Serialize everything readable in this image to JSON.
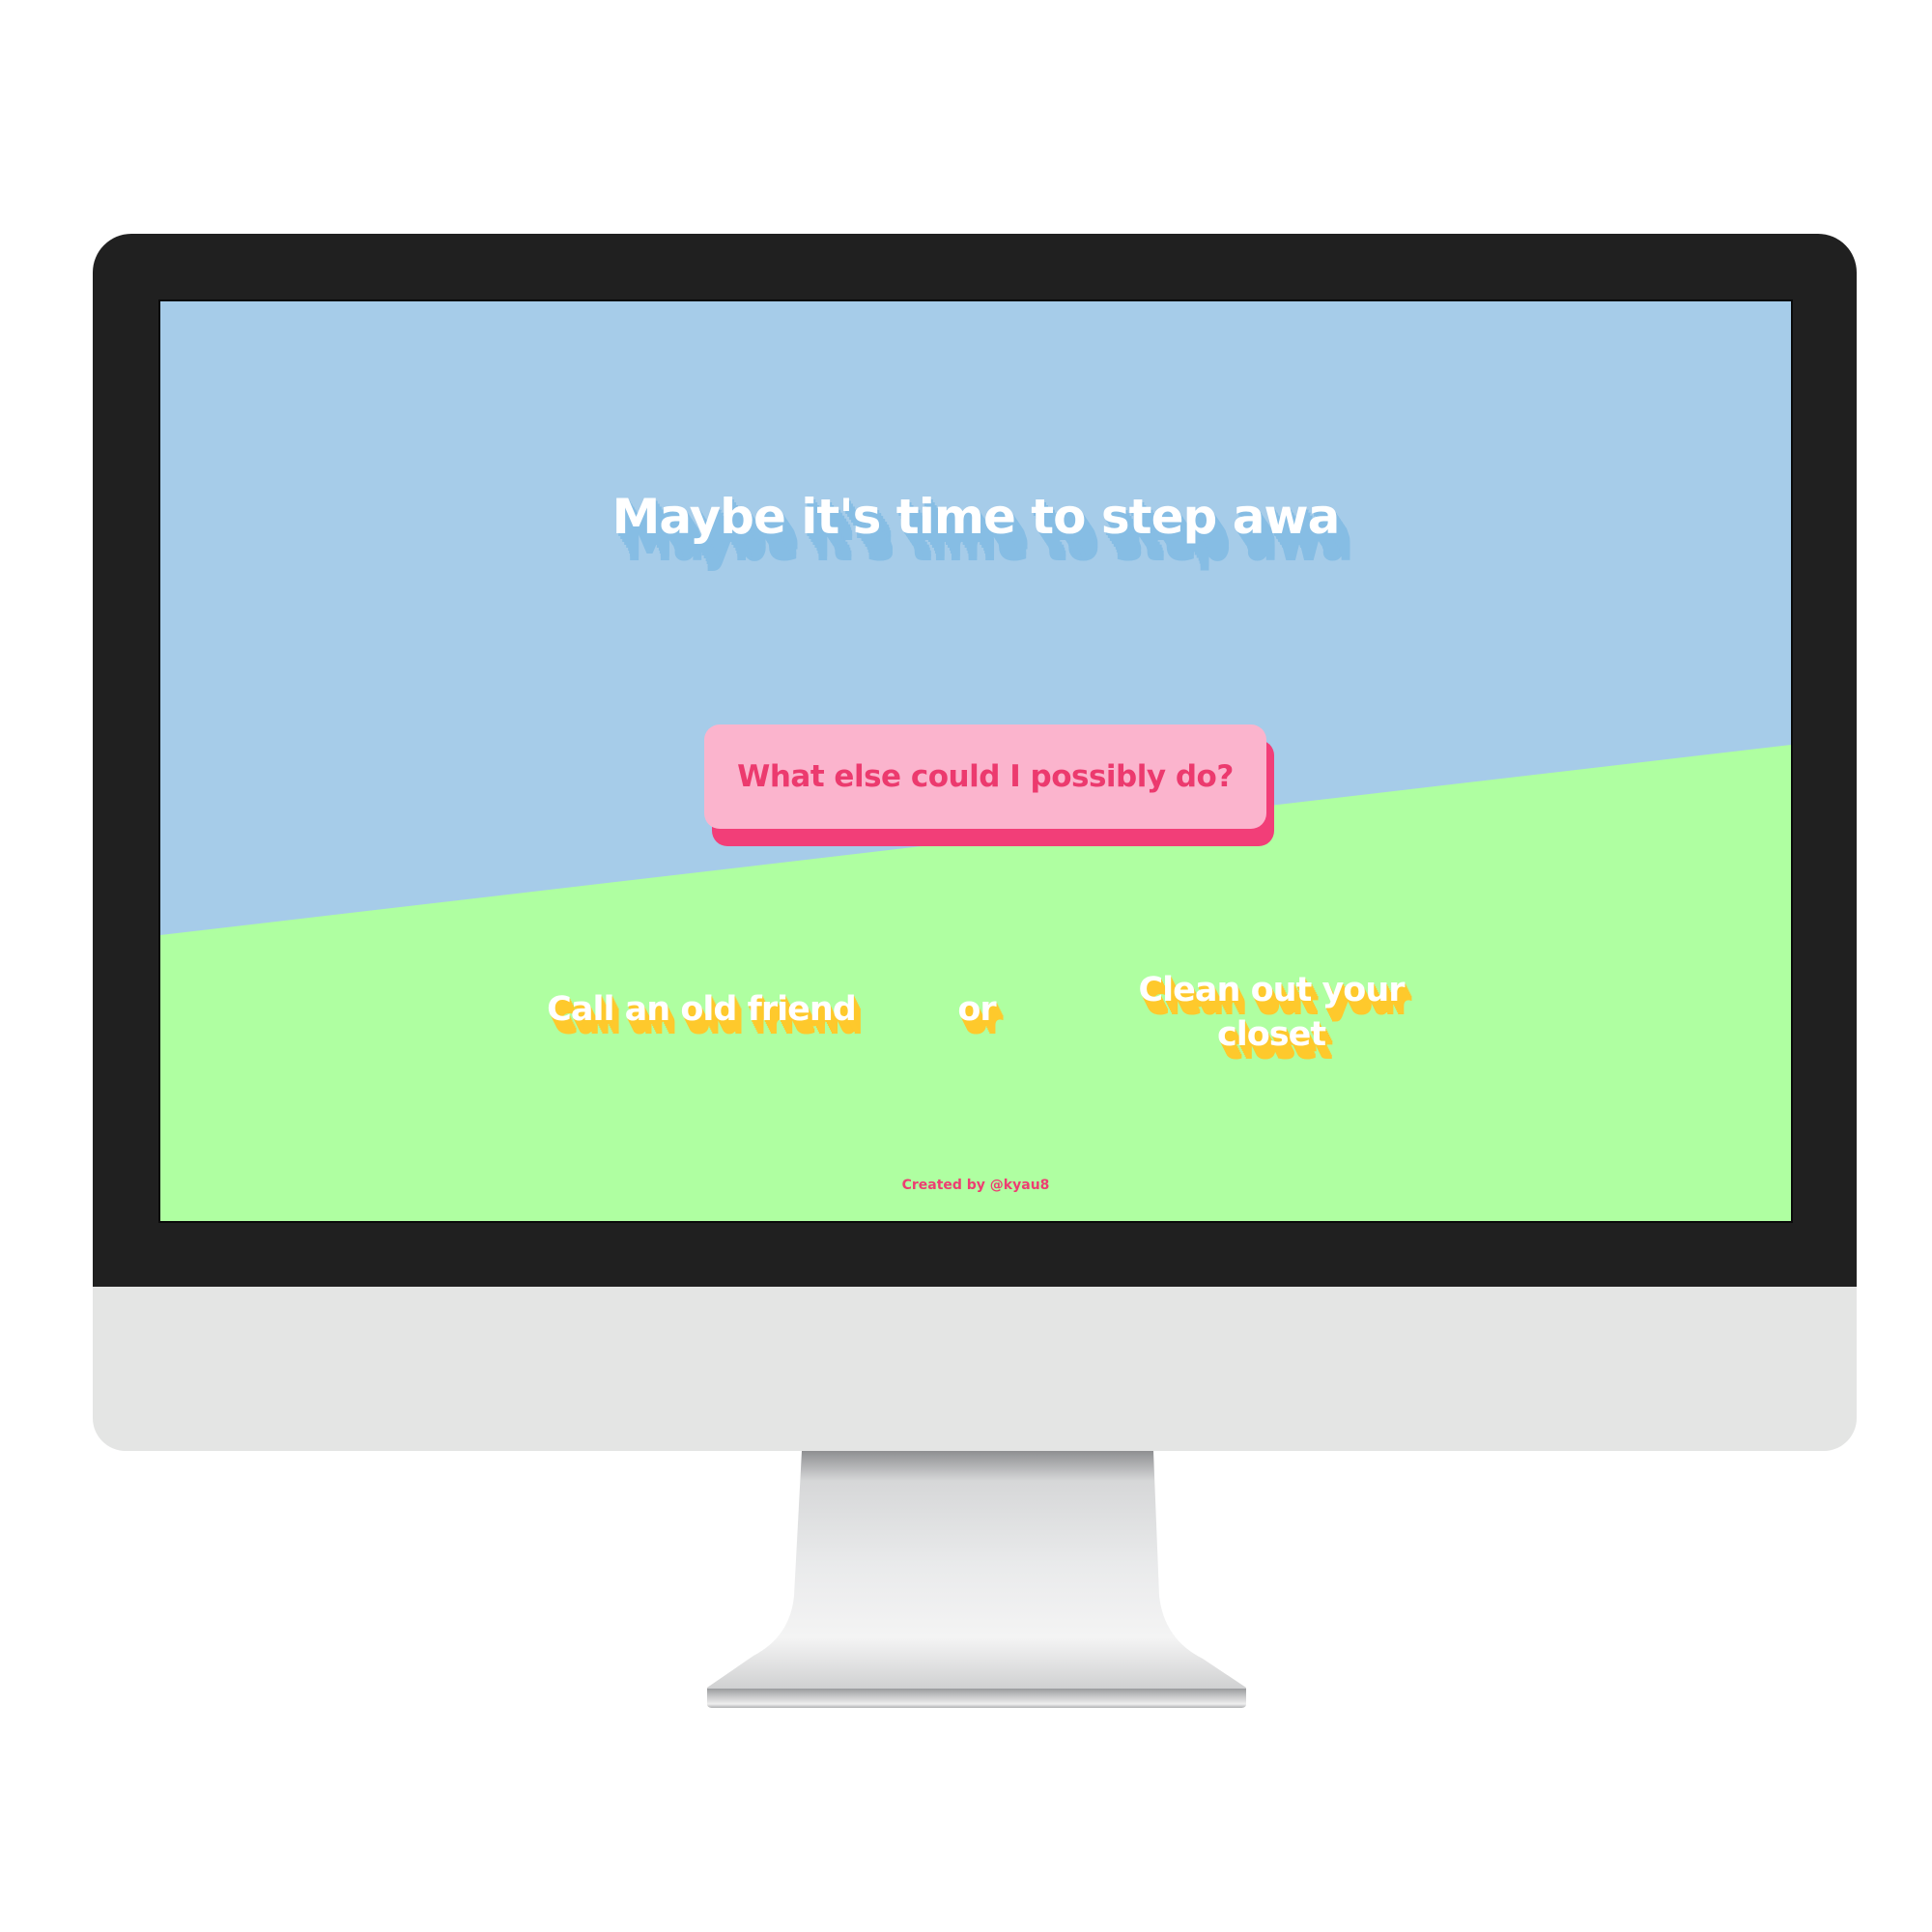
{
  "headline": "Maybe it's time to step awa",
  "cta_label": "What else could I possibly do?",
  "options": {
    "left": "Call an old friend",
    "separator": "or",
    "right": "Clean out your closet"
  },
  "credit": "Created by @kyau8",
  "colors": {
    "sky": "#a6cce9",
    "grass": "#afffa1",
    "headline_shadow": "#86bde4",
    "button_fill": "#fbb4cd",
    "button_text": "#ec3a6e",
    "option_shadow": "#fec92c",
    "bezel": "#202020",
    "chin": "#e4e5e4"
  }
}
